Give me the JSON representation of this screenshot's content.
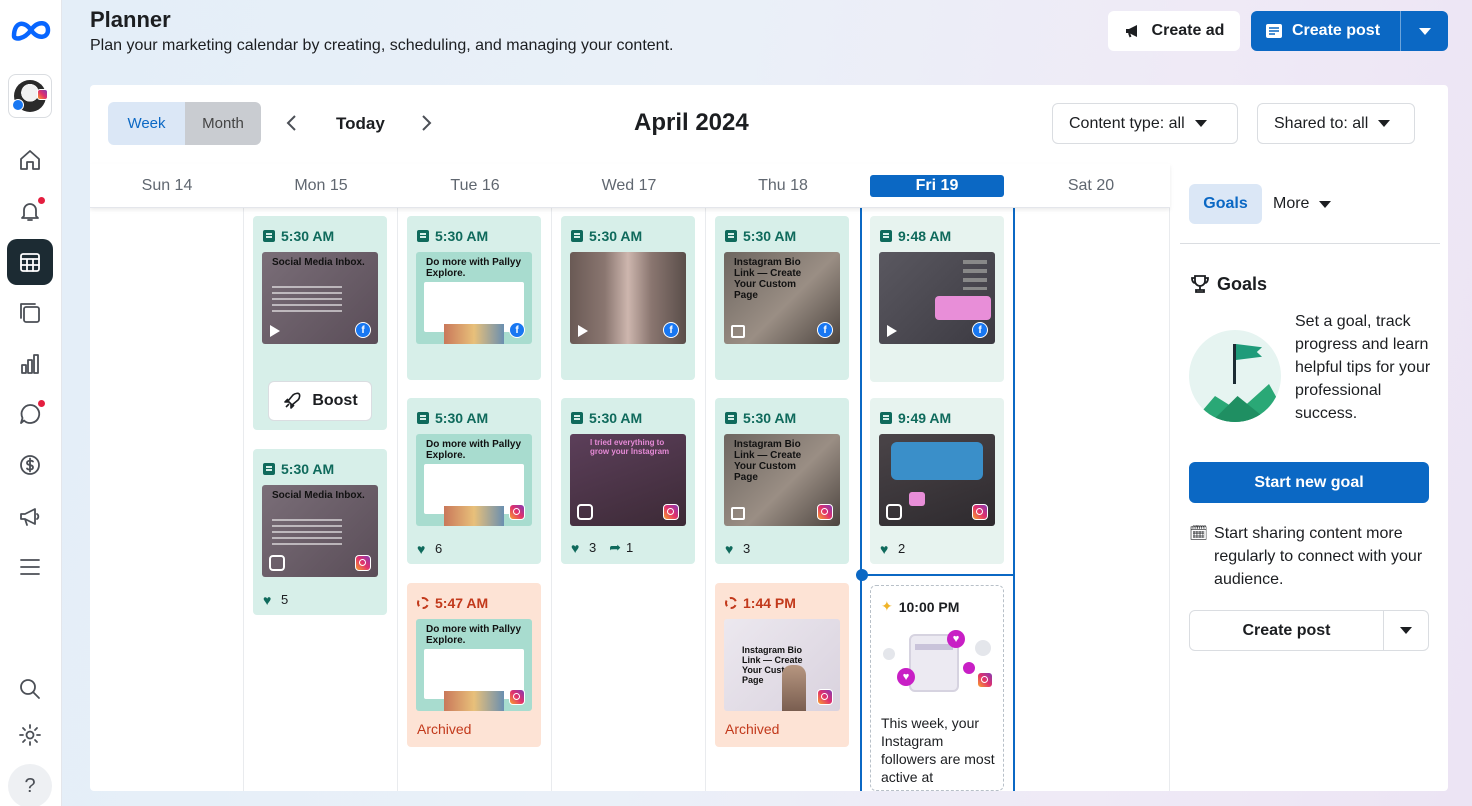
{
  "header": {
    "title": "Planner",
    "subtitle": "Plan your marketing calendar by creating, scheduling, and managing your content.",
    "create_ad": "Create ad",
    "create_post": "Create post"
  },
  "calendar": {
    "view_week": "Week",
    "view_month": "Month",
    "today": "Today",
    "month_title": "April 2024",
    "content_type_filter": "Content type: all",
    "shared_to_filter": "Shared to: all",
    "days": [
      "Sun 14",
      "Mon 15",
      "Tue 16",
      "Wed 17",
      "Thu 18",
      "Fri 19",
      "Sat 20"
    ],
    "today_index": 5
  },
  "cards": {
    "mon1": {
      "time": "5:30 AM",
      "thumb_title": "Social Media Inbox.",
      "boost": "Boost"
    },
    "mon2": {
      "time": "5:30 AM",
      "thumb_title": "Social Media Inbox.",
      "likes": "5"
    },
    "tue1": {
      "time": "5:30 AM",
      "thumb_title": "Do more with Pallyy Explore."
    },
    "tue2": {
      "time": "5:30 AM",
      "thumb_title": "Do more with Pallyy Explore.",
      "likes": "6"
    },
    "tue3": {
      "time": "5:47 AM",
      "thumb_title": "Do more with Pallyy Explore.",
      "status": "Archived"
    },
    "wed1": {
      "time": "5:30 AM"
    },
    "wed2": {
      "time": "5:30 AM",
      "thumb_title": "I tried everything to grow your Instagram",
      "likes": "3",
      "shares": "1"
    },
    "thu1": {
      "time": "5:30 AM",
      "thumb_title": "Instagram Bio Link — Create Your Custom Page"
    },
    "thu2": {
      "time": "5:30 AM",
      "thumb_title": "Instagram Bio Link — Create Your Custom Page",
      "likes": "3"
    },
    "thu3": {
      "time": "1:44 PM",
      "thumb_title": "Instagram Bio Link — Create Your Custom Page",
      "status": "Archived"
    },
    "fri1": {
      "time": "9:48 AM"
    },
    "fri2": {
      "time": "9:49 AM",
      "likes": "2"
    },
    "fri3": {
      "time": "10:00 PM",
      "text": "This week, your Instagram followers are most active at"
    }
  },
  "sidebar": {
    "tab_goals": "Goals",
    "tab_more": "More",
    "goals_heading": "Goals",
    "goals_description": "Set a goal, track progress and learn helpful tips for your professional success.",
    "start_goal": "Start new goal",
    "tip": "Start sharing content more regularly to connect with your audience.",
    "create_post": "Create post"
  },
  "colors": {
    "primary": "#0b68c4",
    "card_green": "#d7efe9",
    "card_orange": "#fde3d5",
    "archived": "#c2391b"
  }
}
